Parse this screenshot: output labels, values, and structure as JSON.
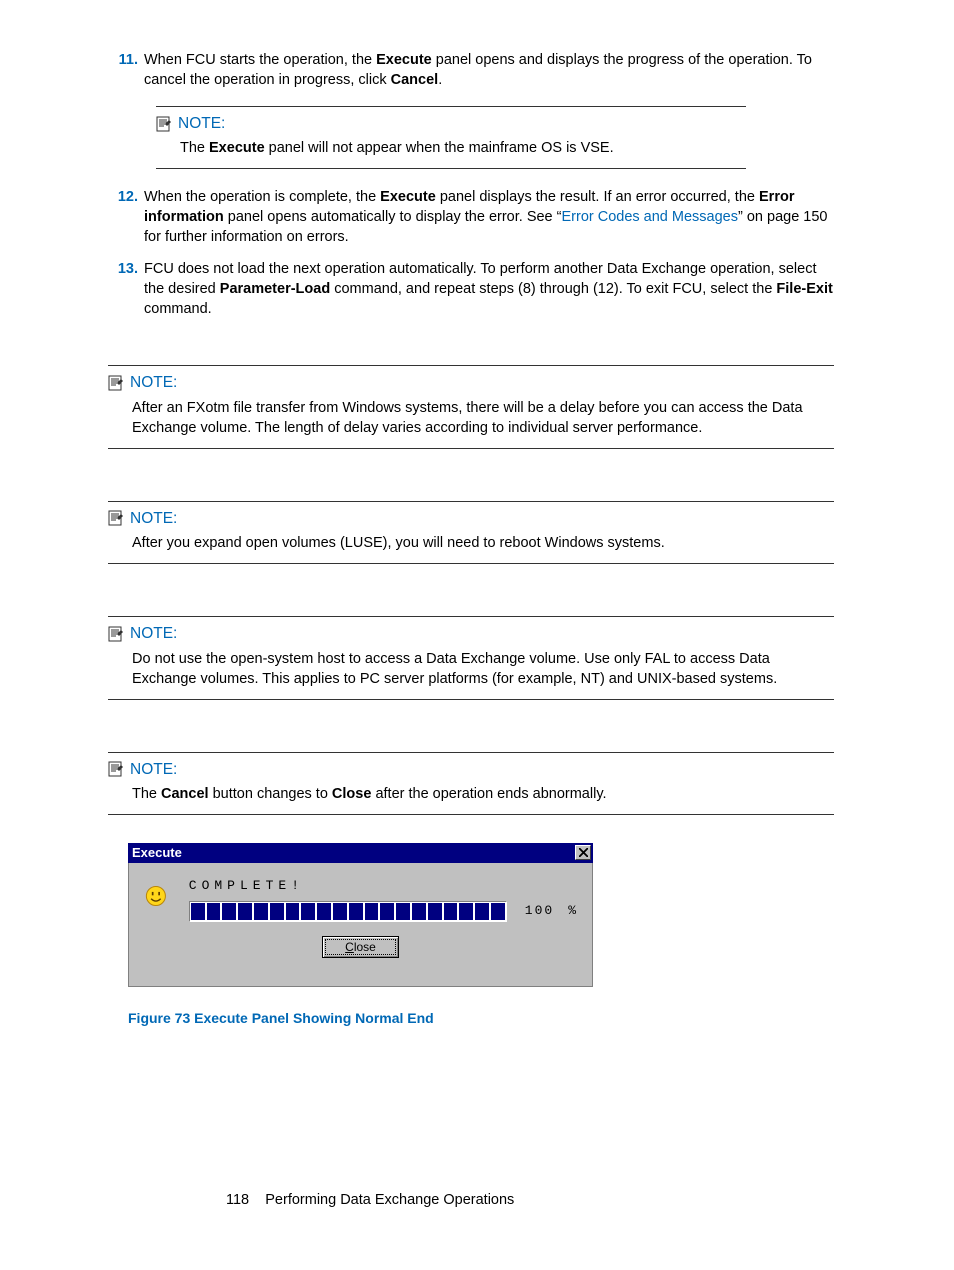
{
  "steps": {
    "s11": {
      "num": "11.",
      "t1": "When FCU starts the operation, the ",
      "b1": "Execute",
      "t2": " panel opens and displays the progress of the operation. To cancel the operation in progress, click ",
      "b2": "Cancel",
      "t3": "."
    },
    "s12": {
      "num": "12.",
      "t1": "When the operation is complete, the ",
      "b1": "Execute",
      "t2": " panel displays the result. If an error occurred, the ",
      "b2": "Error information",
      "t3": " panel opens automatically to display the error. See “",
      "link": "Error Codes and Messages",
      "t4": "” on page 150 for further information on errors."
    },
    "s13": {
      "num": "13.",
      "t1": "FCU does not load the next operation automatically. To perform another Data Exchange operation, select the desired ",
      "b1": "Parameter-Load",
      "t2": " command, and repeat steps (8) through (12). To exit FCU, select the ",
      "b2": "File-Exit",
      "t3": " command."
    }
  },
  "notes": {
    "label": "NOTE:",
    "n1": {
      "t1": "The ",
      "b1": "Execute",
      "t2": " panel will not appear when the mainframe OS is VSE."
    },
    "n2": "After an FXotm file transfer from Windows systems, there will be a delay before you can access the Data Exchange volume. The length of delay varies according to individual server performance.",
    "n3": "After you expand open volumes (LUSE), you will need to reboot Windows systems.",
    "n4": "Do not use the open-system host to access a Data Exchange volume. Use only FAL to access Data Exchange volumes. This applies to PC server platforms (for example, NT) and UNIX-based systems.",
    "n5": {
      "t1": "The ",
      "b1": "Cancel",
      "t2": " button changes to ",
      "b2": "Close",
      "t3": " after the operation ends abnormally."
    }
  },
  "dialog": {
    "title": "Execute",
    "complete": "COMPLETE!",
    "percent": "100",
    "percent_sign": "%",
    "close_underline": "C",
    "close_rest": "lose"
  },
  "figure": "Figure 73 Execute Panel Showing Normal End",
  "footer": {
    "page": "118",
    "title": "Performing Data Exchange Operations"
  }
}
